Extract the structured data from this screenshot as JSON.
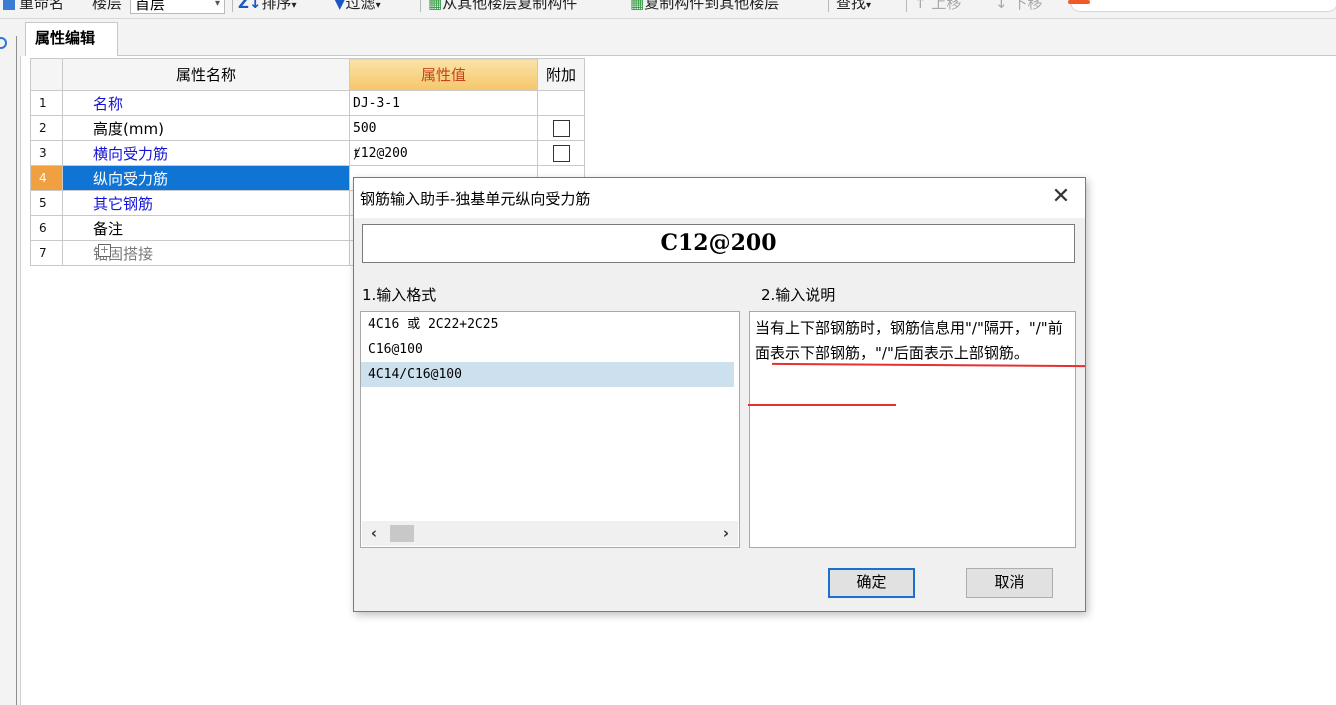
{
  "toolbar": {
    "rename_label": "重命名",
    "floor_label": "楼层",
    "floor_value": "首层",
    "sort_label": "排序",
    "filter_label": "过滤",
    "copy_from_label": "从其他楼层复制构件",
    "copy_to_label": "复制构件到其他楼层",
    "find_label": "查找",
    "move_up_label": "上移",
    "move_down_label": "下移"
  },
  "tab": {
    "label": "属性编辑"
  },
  "grid": {
    "headers": {
      "name": "属性名称",
      "value": "属性值",
      "extra": "附加"
    },
    "rows": [
      {
        "num": "1",
        "name": "名称",
        "value": "DJ-3-1"
      },
      {
        "num": "2",
        "name": "高度(mm)",
        "value": "500"
      },
      {
        "num": "3",
        "name": "横向受力筋",
        "value": "ⱦ12@200"
      },
      {
        "num": "4",
        "name": "纵向受力筋",
        "value": ""
      },
      {
        "num": "5",
        "name": "其它钢筋",
        "value": ""
      },
      {
        "num": "6",
        "name": "备注",
        "value": ""
      },
      {
        "num": "7",
        "name": "锚固搭接",
        "value": ""
      }
    ],
    "selected_row": "4"
  },
  "dialog": {
    "title": "钢筋输入助手-独基单元纵向受力筋",
    "value": "C12@200",
    "format_label": "1.输入格式",
    "desc_label": "2.输入说明",
    "formats": [
      "4C16 或 2C22+2C25",
      "C16@100",
      "4C14/C16@100"
    ],
    "selected_format": "4C14/C16@100",
    "description": "当有上下部钢筋时，钢筋信息用\"/\"隔开，\"/\"前面表示下部钢筋，\"/\"后面表示上部钢筋。",
    "ok_label": "确定",
    "cancel_label": "取消"
  },
  "colors": {
    "selected_row": "#0f74d4",
    "row_number_highlight": "#f0a040",
    "annotation": "#e53030"
  }
}
